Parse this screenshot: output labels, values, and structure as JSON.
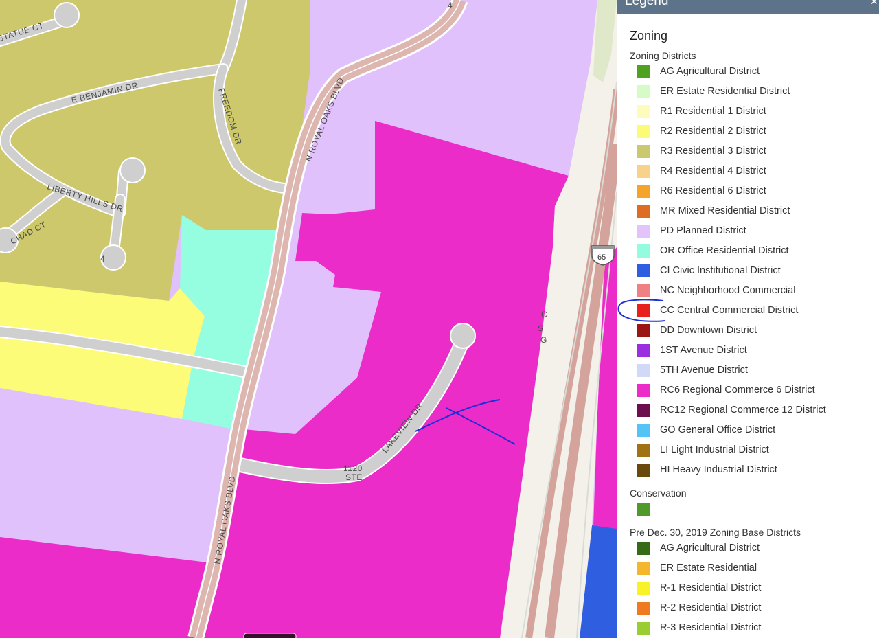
{
  "map": {
    "road_labels": {
      "statue_ct": "STATUE CT",
      "e_benjamin": "E BENJAMIN DR",
      "freedom": "FREEDOM DR",
      "liberty_hills": "LIBERTY HILLS DR",
      "chad_ct": "CHAD CT",
      "n_royal_oaks_top": "N ROYAL OAKS BLVD",
      "n_royal_oaks_bottom": "N ROYAL OAKS BLVD",
      "lakeview": "LAKEVIEW DR",
      "stub_1120": "1120",
      "stub_ste": "STE",
      "num_4_top": "4",
      "num_4_left": "4",
      "fragment_c": "C",
      "fragment_s": "S",
      "fragment_g": "G"
    },
    "highway_shield": "65",
    "colors": {
      "r3": "#cdc86c",
      "pd": "#e1c1fc",
      "rc6": "#ec2cc8",
      "or": "#95fde0",
      "r2": "#fcfc78",
      "road": "#cfcfcf",
      "road_edge": "#ffffff",
      "blvd": "#ddb6b0",
      "highway": "#d4a39b",
      "annotation": "#1a2fd8",
      "ci": "#2f5fe0"
    }
  },
  "legend": {
    "panel_title": "Legend",
    "close_glyph": "×",
    "layer_title": "Zoning",
    "groups": [
      {
        "title": "Zoning Districts",
        "items": [
          {
            "label": "AG Agricultural District",
            "color": "#4ea21f"
          },
          {
            "label": "ER Estate Residential District",
            "color": "#d7fbc7"
          },
          {
            "label": "R1 Residential 1 District",
            "color": "#fdfcbd"
          },
          {
            "label": "R2 Residential 2 District",
            "color": "#fcfb78"
          },
          {
            "label": "R3 Residential 3 District",
            "color": "#cbc970"
          },
          {
            "label": "R4 Residential 4 District",
            "color": "#f8d28a"
          },
          {
            "label": "R6 Residential 6 District",
            "color": "#f5a42b"
          },
          {
            "label": "MR Mixed Residential District",
            "color": "#de6c22"
          },
          {
            "label": "PD Planned District",
            "color": "#e2c4fb"
          },
          {
            "label": "OR Office Residential District",
            "color": "#93fbde"
          },
          {
            "label": "CI Civic Institutional District",
            "color": "#2f5fe0"
          },
          {
            "label": "NC Neighborhood Commercial",
            "color": "#ee8282"
          },
          {
            "label": "CC Central Commercial District",
            "color": "#e8201d"
          },
          {
            "label": "DD Downtown District",
            "color": "#9c1515"
          },
          {
            "label": "1ST Avenue District",
            "color": "#9b2fe0"
          },
          {
            "label": "5TH Avenue District",
            "color": "#d2d8f8"
          },
          {
            "label": "RC6 Regional Commerce 6 District",
            "color": "#ec2cc8"
          },
          {
            "label": "RC12 Regional Commerce 12 District",
            "color": "#6b0d4f"
          },
          {
            "label": "GO General Office District",
            "color": "#53c4f5"
          },
          {
            "label": "LI Light Industrial District",
            "color": "#a17215"
          },
          {
            "label": "HI Heavy Industrial District",
            "color": "#6a4a0c"
          }
        ]
      },
      {
        "title": "Conservation",
        "items": [
          {
            "label": "",
            "color": "#4f9a2b"
          }
        ]
      },
      {
        "title": "Pre Dec. 30, 2019 Zoning Base Districts",
        "items": [
          {
            "label": "AG Agricultural District",
            "color": "#356b17"
          },
          {
            "label": "ER Estate Residential",
            "color": "#f4b62d"
          },
          {
            "label": "R-1 Residential District",
            "color": "#f8f227"
          },
          {
            "label": "R-2 Residential District",
            "color": "#ee7a22"
          },
          {
            "label": "R-3 Residential District",
            "color": "#9acd32"
          }
        ]
      }
    ]
  }
}
